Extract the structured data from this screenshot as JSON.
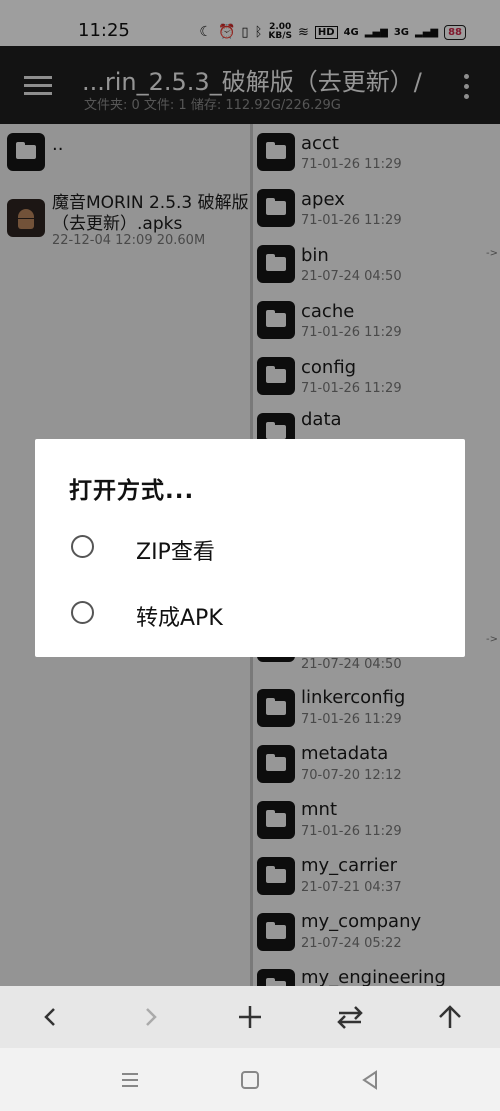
{
  "status": {
    "time": "11:25",
    "net_speed_top": "2.00",
    "net_speed_bottom": "KB/S",
    "hd": "HD",
    "sig1": "4G",
    "sig2": "3G",
    "battery": "88"
  },
  "app": {
    "title": "...rin_2.5.3_破解版（去更新）/",
    "subtitle": "文件夹: 0  文件: 1  储存: 112.92G/226.29G"
  },
  "left": {
    "parent_label": "..",
    "file": {
      "name_line1": "魔音MORIN 2.5.3 破解版",
      "name_line2": "（去更新）.apks",
      "meta": "22-12-04 12:09  20.60M"
    }
  },
  "right": [
    {
      "name": "acct",
      "meta": "71-01-26 11:29"
    },
    {
      "name": "apex",
      "meta": "71-01-26 11:29"
    },
    {
      "name": "bin",
      "meta": "21-07-24 04:50",
      "symlink": "->"
    },
    {
      "name": "cache",
      "meta": "71-01-26 11:29"
    },
    {
      "name": "config",
      "meta": "71-01-26 11:29"
    },
    {
      "name": "data",
      "meta": ""
    }
  ],
  "right_lower": [
    {
      "name": "",
      "meta": "21-07-24 04:50",
      "symlink": "->"
    },
    {
      "name": "linkerconfig",
      "meta": "71-01-26 11:29"
    },
    {
      "name": "metadata",
      "meta": "70-07-20 12:12"
    },
    {
      "name": "mnt",
      "meta": "71-01-26 11:29"
    },
    {
      "name": "my_carrier",
      "meta": "21-07-21 04:37"
    },
    {
      "name": "my_company",
      "meta": "21-07-24 05:22"
    },
    {
      "name": "my_engineering",
      "meta": ""
    }
  ],
  "dialog": {
    "title": "打开方式...",
    "options": [
      {
        "label": "ZIP查看"
      },
      {
        "label": "转成APK"
      }
    ]
  },
  "toolbar_icons": [
    "back-arrow-icon",
    "forward-arrow-icon",
    "plus-icon",
    "swap-icon",
    "up-arrow-icon"
  ],
  "nav_icons": [
    "recents-menu-icon",
    "home-square-icon",
    "back-triangle-icon"
  ]
}
